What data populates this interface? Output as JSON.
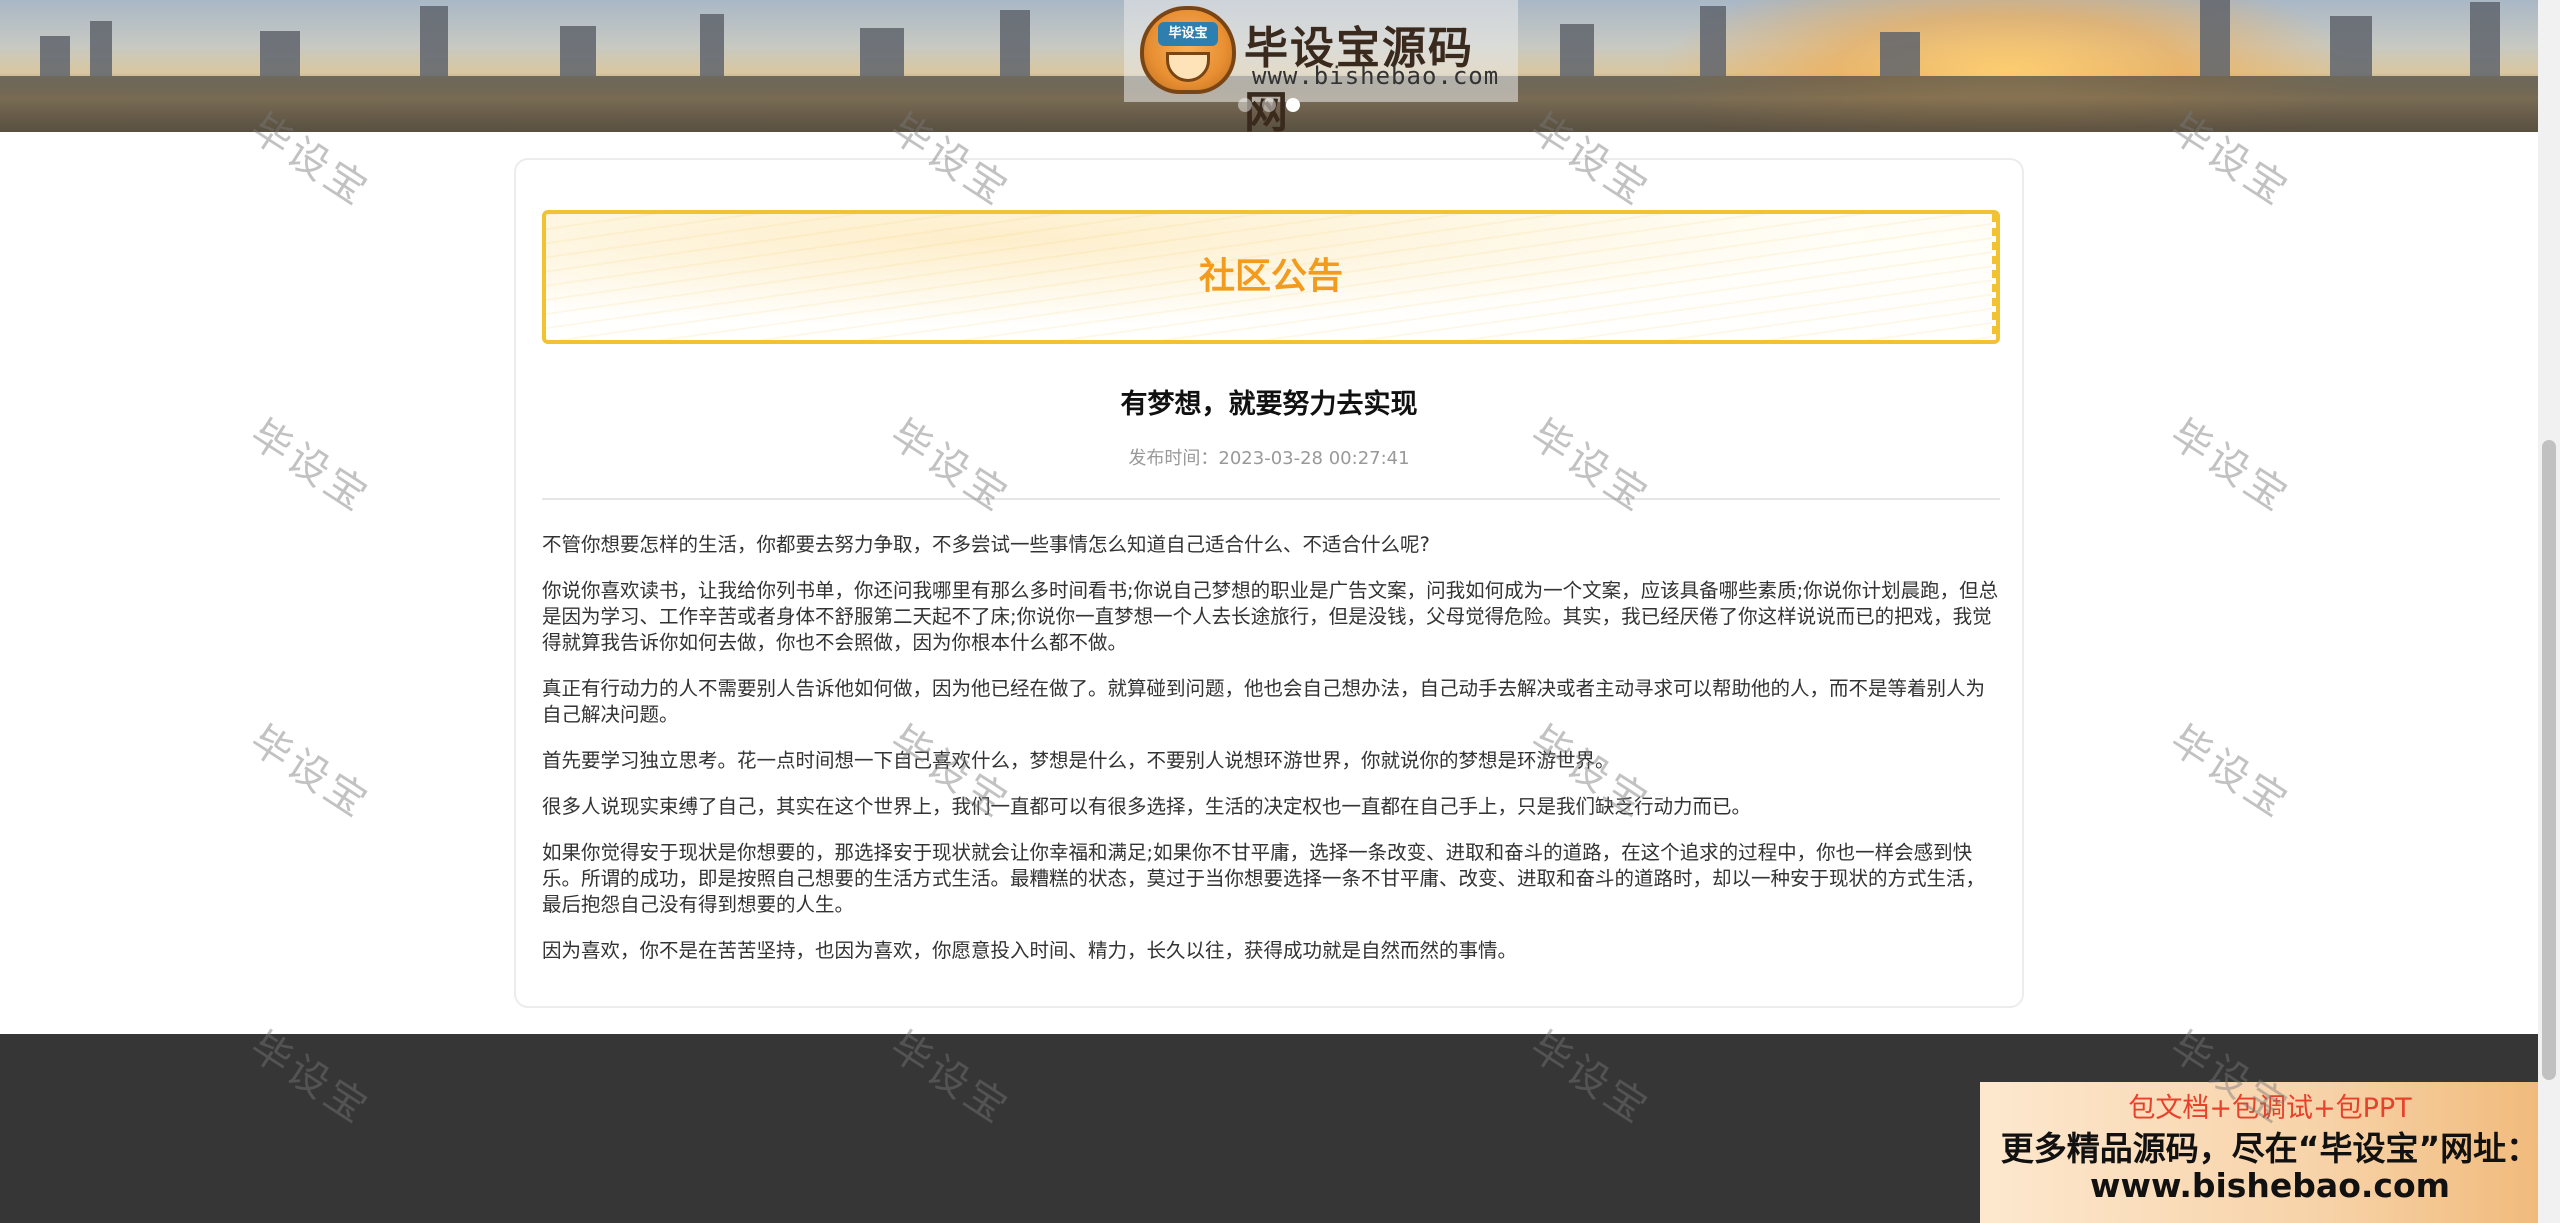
{
  "banner": {
    "logo_title": "毕设宝源码网",
    "logo_url": "www.bishebao.com",
    "logo_emblem_text": "毕设宝",
    "carousel_dots": 3,
    "carousel_active_index": 3
  },
  "notice": {
    "header_title": "社区公告"
  },
  "article": {
    "title": "有梦想，就要努力去实现",
    "meta": "发布时间：2023-03-28 00:27:41",
    "paragraphs": [
      "不管你想要怎样的生活，你都要去努力争取，不多尝试一些事情怎么知道自己适合什么、不适合什么呢?",
      "你说你喜欢读书，让我给你列书单，你还问我哪里有那么多时间看书;你说自己梦想的职业是广告文案，问我如何成为一个文案，应该具备哪些素质;你说你计划晨跑，但总是因为学习、工作辛苦或者身体不舒服第二天起不了床;你说你一直梦想一个人去长途旅行，但是没钱，父母觉得危险。其实，我已经厌倦了你这样说说而已的把戏，我觉得就算我告诉你如何去做，你也不会照做，因为你根本什么都不做。",
      "真正有行动力的人不需要别人告诉他如何做，因为他已经在做了。就算碰到问题，他也会自己想办法，自己动手去解决或者主动寻求可以帮助他的人，而不是等着别人为自己解决问题。",
      "首先要学习独立思考。花一点时间想一下自己喜欢什么，梦想是什么，不要别人说想环游世界，你就说你的梦想是环游世界。",
      "很多人说现实束缚了自己，其实在这个世界上，我们一直都可以有很多选择，生活的决定权也一直都在自己手上，只是我们缺乏行动力而已。",
      "如果你觉得安于现状是你想要的，那选择安于现状就会让你幸福和满足;如果你不甘平庸，选择一条改变、进取和奋斗的道路，在这个追求的过程中，你也一样会感到快乐。所谓的成功，即是按照自己想要的生活方式生活。最糟糕的状态，莫过于当你想要选择一条不甘平庸、改变、进取和奋斗的道路时，却以一种安于现状的方式生活，最后抱怨自己没有得到想要的人生。",
      "因为喜欢，你不是在苦苦坚持，也因为喜欢，你愿意投入时间、精力，长久以往，获得成功就是自然而然的事情。"
    ]
  },
  "promo": {
    "line1": "包文档+包调试+包PPT",
    "line2": "更多精品源码，尽在“毕设宝”网址：",
    "line3": "www.bishebao.com"
  },
  "watermark": {
    "text": "毕设宝"
  },
  "colors": {
    "notice_title": "#f29b1d",
    "notice_border": "#f1c232",
    "footer_bg": "#363636",
    "promo_red": "#e8412b"
  }
}
